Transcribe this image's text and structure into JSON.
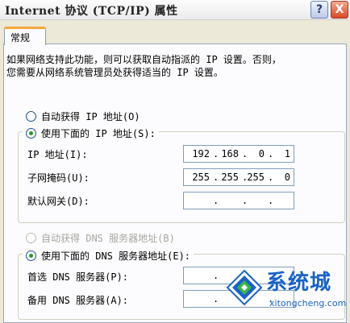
{
  "window": {
    "title": "Internet 协议 (TCP/IP) 属性",
    "help_label": "?",
    "close_label": "X"
  },
  "tabs": [
    {
      "label": "常规"
    }
  ],
  "description": {
    "line1": "如果网络支持此功能，则可以获取自动指派的 IP 设置。否则，",
    "line2": "您需要从网络系统管理员处获得适当的 IP 设置。"
  },
  "ip_mode": {
    "auto_label": "自动获得 IP 地址(O)",
    "auto_checked": false,
    "manual_label": "使用下面的 IP 地址(S):",
    "manual_checked": true
  },
  "ip_fields": [
    {
      "label": "IP 地址(I):",
      "octets": [
        "192",
        "168",
        "0",
        "1"
      ]
    },
    {
      "label": "子网掩码(U):",
      "octets": [
        "255",
        "255",
        "255",
        "0"
      ]
    },
    {
      "label": "默认网关(D):",
      "octets": [
        "",
        "",
        "",
        ""
      ]
    }
  ],
  "dns_mode": {
    "auto_label": "自动获得 DNS 服务器地址(B)",
    "auto_enabled": false,
    "manual_label": "使用下面的 DNS 服务器地址(E):",
    "manual_checked": true
  },
  "dns_fields": [
    {
      "label": "首选 DNS 服务器(P):",
      "octets": [
        "",
        "",
        "",
        ""
      ]
    },
    {
      "label": "备用 DNS 服务器(A):",
      "octets": [
        "",
        "",
        "",
        ""
      ]
    }
  ],
  "watermark": {
    "brand_cn": "系统城",
    "brand_en": "xitongcheng.com",
    "colors": {
      "blue": "#1a63c5",
      "green": "#3bb54a"
    }
  },
  "colors": {
    "dialog_bg": "#ece9d8",
    "panel_bg": "#fcfcfe",
    "tab_accent": "#f5a63c",
    "radio_dot": "#21a121",
    "field_border": "#7f9db9"
  }
}
